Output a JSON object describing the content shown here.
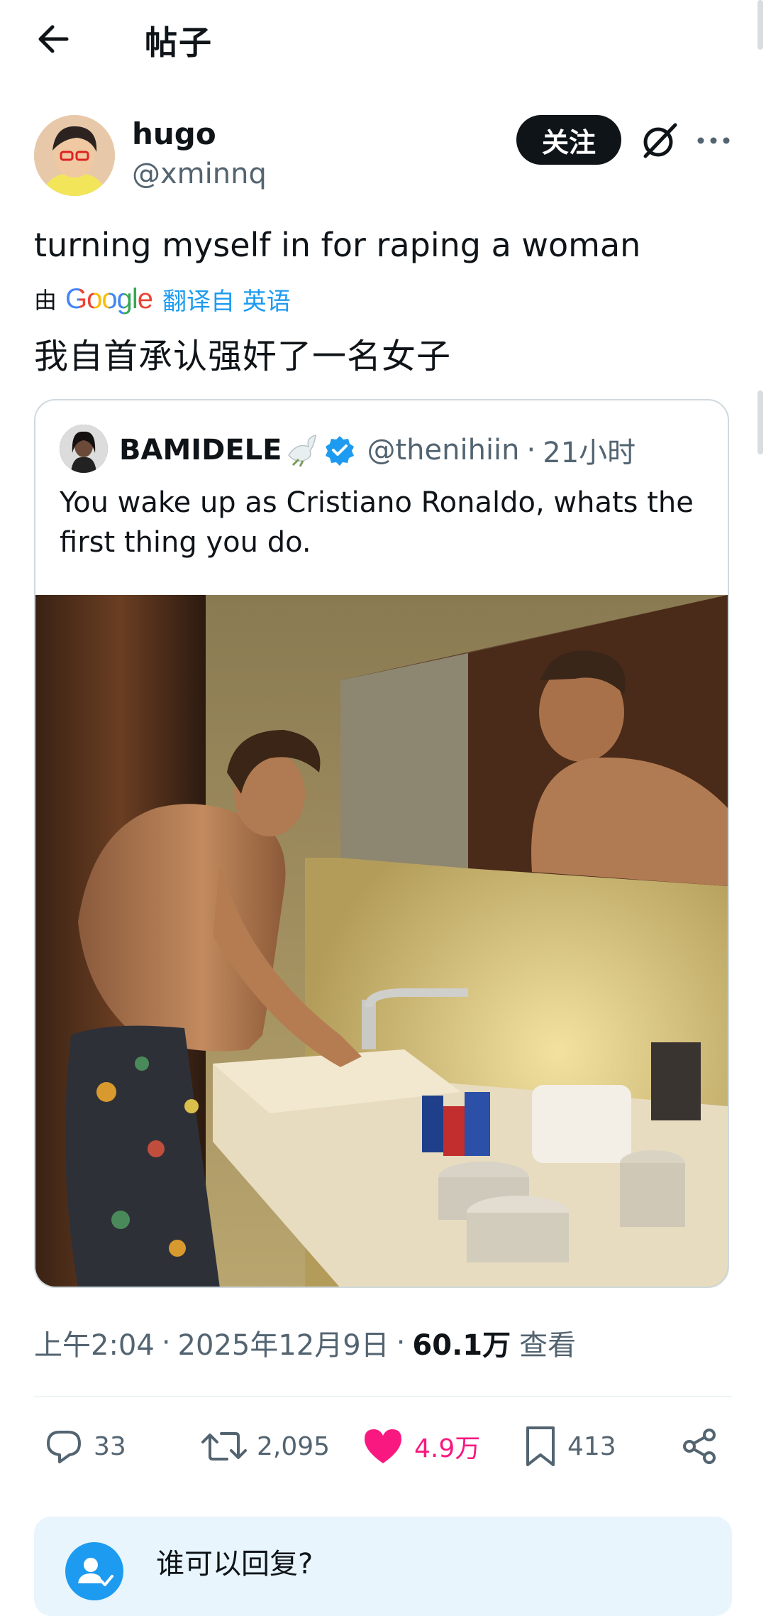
{
  "header": {
    "title": "帖子"
  },
  "post": {
    "display_name": "hugo",
    "handle": "@xminnq",
    "follow_label": "关注",
    "text_original": "turning myself in for raping a woman",
    "translated_by": "由",
    "translated_logo": "Google",
    "translated_from": "翻译自 英语",
    "text_translated": "我自首承认强奸了一名女子"
  },
  "quote": {
    "display_name": "BAMIDELE",
    "handle": "@thenihiin",
    "separator": "·",
    "time": "21小时",
    "text": "You wake up as Cristiano Ronaldo, whats the first thing you do."
  },
  "meta": {
    "time": "上午2:04",
    "date": "2025年12月9日",
    "views_count": "60.1万",
    "views_label": "查看",
    "sep": "·"
  },
  "actions": {
    "replies": "33",
    "reposts": "2,095",
    "likes": "4.9万",
    "bookmarks": "413"
  },
  "reply_settings": {
    "title": "谁可以回复?"
  },
  "colors": {
    "accent": "#1d9bf0",
    "like": "#f91880",
    "text": "#0f1419",
    "muted": "#536471"
  },
  "icons": [
    "back-arrow-icon",
    "grok-icon",
    "more-icon",
    "verified-badge-icon",
    "dove-emoji-icon",
    "reply-icon",
    "repost-icon",
    "like-icon",
    "bookmark-icon",
    "share-icon",
    "person-check-icon"
  ]
}
